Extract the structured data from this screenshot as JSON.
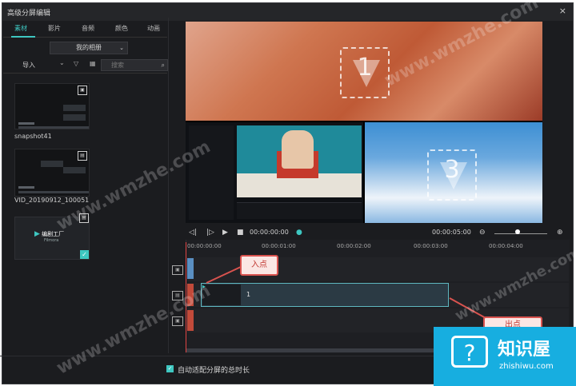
{
  "window": {
    "title": "高级分屏编辑",
    "close_icon": "×"
  },
  "tabs": [
    "素材",
    "影片",
    "音频",
    "颜色",
    "动画"
  ],
  "album_select": {
    "value": "我的相册"
  },
  "toolbar": {
    "import_label": "导入",
    "search_placeholder": "搜索"
  },
  "media_items": [
    {
      "name": "snapshot41",
      "sub": [
        "1 Scenes",
        "1 Scenes"
      ]
    },
    {
      "name": "VID_20190912_100051",
      "sub": [
        "1 Scenes",
        "1 Scenes"
      ]
    },
    {
      "name": "",
      "logo_text": "编剧工厂",
      "logo_sub": "Filmora"
    }
  ],
  "preview": {
    "slot1": "1",
    "slot3": "3"
  },
  "controls": {
    "current_time": "00:00:00:00",
    "total_time": "00:00:05:00"
  },
  "timeline": {
    "ruler": [
      "00:00:00:00",
      "00:00:01:00",
      "00:00:02:00",
      "00:00:03:00",
      "00:00:04:00"
    ],
    "clip_number": "1"
  },
  "callouts": {
    "in_point": "入点",
    "out_point": "出点"
  },
  "footer": {
    "auto_fit_label": "自动适配分屏的总时长"
  },
  "brand": {
    "name": "知识屋",
    "url": "zhishiwu.com",
    "logo_glyph": "?"
  },
  "watermark": "www.wmzhe.com",
  "colors": {
    "accent": "#3ec7c1",
    "callout_red": "#d9534f",
    "brand_blue": "#17aee0"
  }
}
